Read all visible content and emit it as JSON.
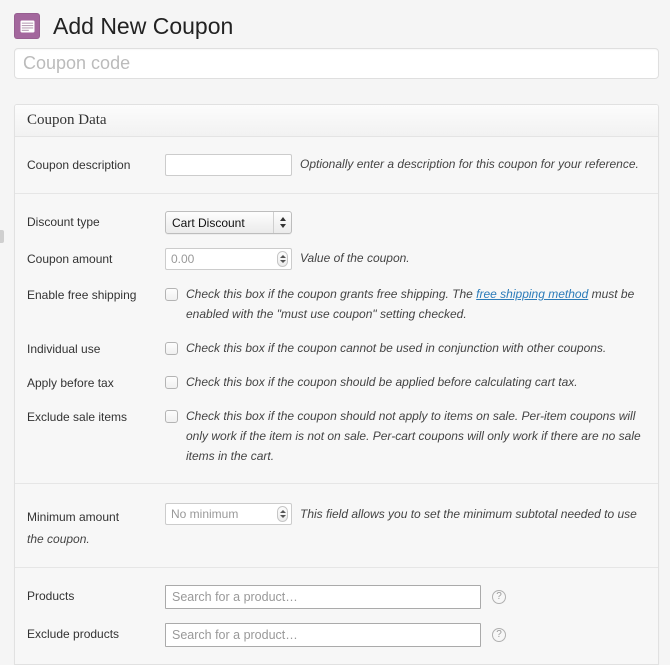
{
  "page": {
    "title": "Add New Coupon",
    "title_icon": "coupon-ticket-icon"
  },
  "coupon_code": {
    "value": "",
    "placeholder": "Coupon code"
  },
  "panel": {
    "header": "Coupon Data",
    "sections": [
      {
        "rows": [
          {
            "type": "text",
            "label": "Coupon description",
            "value": "",
            "placeholder": "",
            "description": "Optionally enter a description for this coupon for your reference."
          }
        ]
      },
      {
        "rows": [
          {
            "type": "select",
            "label": "Discount type",
            "value": "Cart Discount",
            "options": [
              "Cart Discount"
            ],
            "description": ""
          },
          {
            "type": "number",
            "label": "Coupon amount",
            "value": "",
            "placeholder": "0.00",
            "description": "Value of the coupon."
          },
          {
            "type": "checkbox",
            "label": "Enable free shipping",
            "checked": false,
            "description_before": "Check this box if the coupon grants free shipping. The ",
            "link_text": "free shipping method",
            "description_after": " must be enabled with the \"must use coupon\" setting checked."
          },
          {
            "type": "checkbox",
            "label": "Individual use",
            "checked": false,
            "description": "Check this box if the coupon cannot be used in conjunction with other coupons."
          },
          {
            "type": "checkbox",
            "label": "Apply before tax",
            "checked": false,
            "description": "Check this box if the coupon should be applied before calculating cart tax."
          },
          {
            "type": "checkbox",
            "label": "Exclude sale items",
            "checked": false,
            "description": "Check this box if the coupon should not apply to items on sale. Per-item coupons will only work if the item is not on sale. Per-cart coupons will only work if there are no sale items in the cart."
          }
        ]
      },
      {
        "rows": [
          {
            "type": "number",
            "label": "Minimum amount",
            "value": "",
            "placeholder": "No minimum",
            "description": "This field allows you to set the minimum subtotal needed to use the coupon."
          }
        ]
      },
      {
        "rows": [
          {
            "type": "search",
            "label": "Products",
            "value": "",
            "placeholder": "Search for a product…",
            "help": "?"
          },
          {
            "type": "search",
            "label": "Exclude products",
            "value": "",
            "placeholder": "Search for a product…",
            "help": "?"
          }
        ]
      }
    ]
  },
  "colors": {
    "accent": "#a3679d",
    "link": "#2b7bb9",
    "panel_bg": "#f7f7f7",
    "page_bg": "#f5f5f5"
  }
}
